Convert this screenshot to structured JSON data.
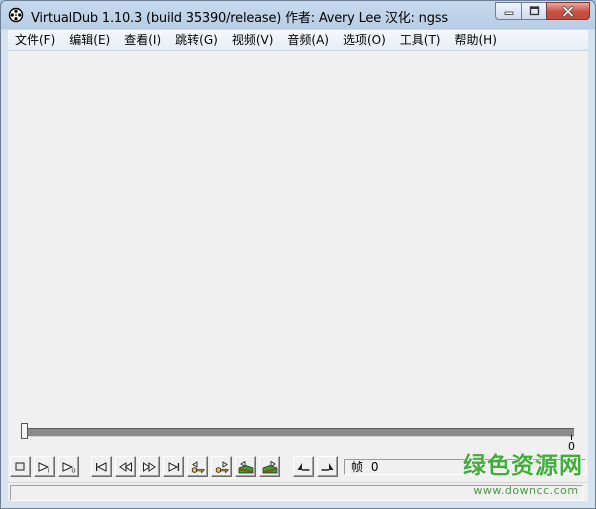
{
  "window": {
    "title": "VirtualDub 1.10.3 (build 35390/release) 作者: Avery Lee  汉化: ngss",
    "icons": {
      "app": "film-reel-icon",
      "minimize": "minimize-icon",
      "maximize": "maximize-icon",
      "close": "close-icon"
    }
  },
  "menubar": {
    "items": [
      {
        "label": "文件(F)"
      },
      {
        "label": "编辑(E)"
      },
      {
        "label": "查看(I)"
      },
      {
        "label": "跳转(G)"
      },
      {
        "label": "视频(V)"
      },
      {
        "label": "音频(A)"
      },
      {
        "label": "选项(O)"
      },
      {
        "label": "工具(T)"
      },
      {
        "label": "帮助(H)"
      }
    ]
  },
  "timeline": {
    "position": 0,
    "end_label": "0"
  },
  "toolbar": {
    "buttons": [
      {
        "icon": "stop-icon"
      },
      {
        "icon": "play-input-icon"
      },
      {
        "icon": "play-output-icon"
      },
      {
        "icon": "go-to-start-icon"
      },
      {
        "icon": "previous-frame-icon"
      },
      {
        "icon": "next-frame-icon"
      },
      {
        "icon": "go-to-end-icon"
      },
      {
        "icon": "previous-keyframe-icon"
      },
      {
        "icon": "next-keyframe-icon"
      },
      {
        "icon": "scene-back-icon"
      },
      {
        "icon": "scene-forward-icon"
      },
      {
        "icon": "mark-in-icon"
      },
      {
        "icon": "mark-out-icon"
      }
    ]
  },
  "frame_indicator": {
    "label": "帧",
    "value": "0"
  },
  "watermark": {
    "text": "绿色资源网",
    "url": "www.downcc.com",
    "color": "#3fae3a"
  },
  "colors": {
    "titlebar": "#b8cde5",
    "client": "#f0f0f0",
    "close_button": "#c9503f"
  }
}
